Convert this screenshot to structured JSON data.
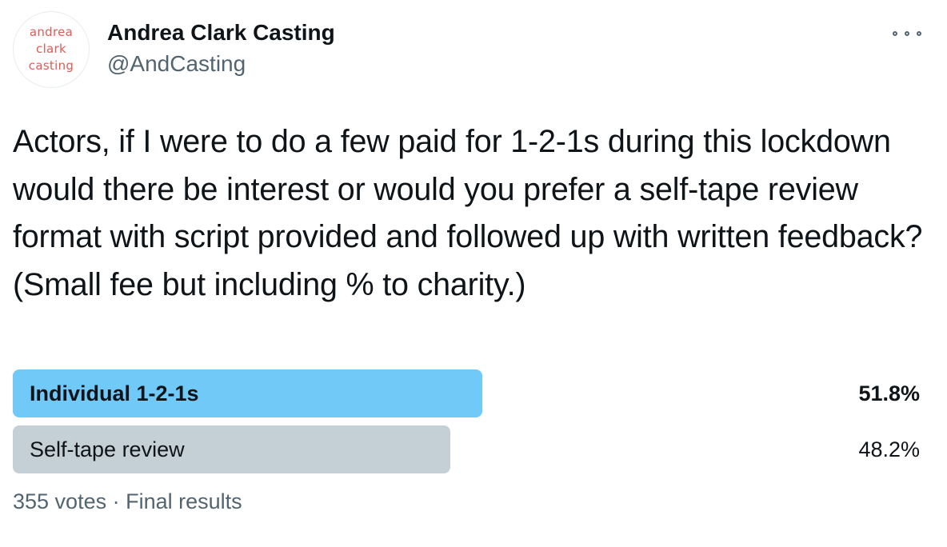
{
  "author": {
    "avatar_text": "andrea\nclark\ncasting",
    "display_name": "Andrea Clark Casting",
    "handle": "@AndCasting"
  },
  "more_menu_icon": "more-horizontal-icon",
  "tweet": {
    "text": "Actors, if I were to do a few paid for 1-2-1s during this lockdown would there be interest or would you prefer a self-tape review format with script provided and followed up with written feedback? (Small fee but including % to charity.)"
  },
  "poll": {
    "options": [
      {
        "label": "Individual 1-2-1s",
        "percent_text": "51.8%",
        "fraction": 0.518,
        "winner": true,
        "color": "#71c9f8"
      },
      {
        "label": "Self-tape review",
        "percent_text": "48.2%",
        "fraction": 0.482,
        "winner": false,
        "color": "#c4cfd6"
      }
    ],
    "votes": "355 votes",
    "separator": "·",
    "status": "Final results"
  },
  "colors": {
    "avatar_text": "#e15a55",
    "secondary_text": "#536471",
    "primary_text": "#0f1419"
  }
}
